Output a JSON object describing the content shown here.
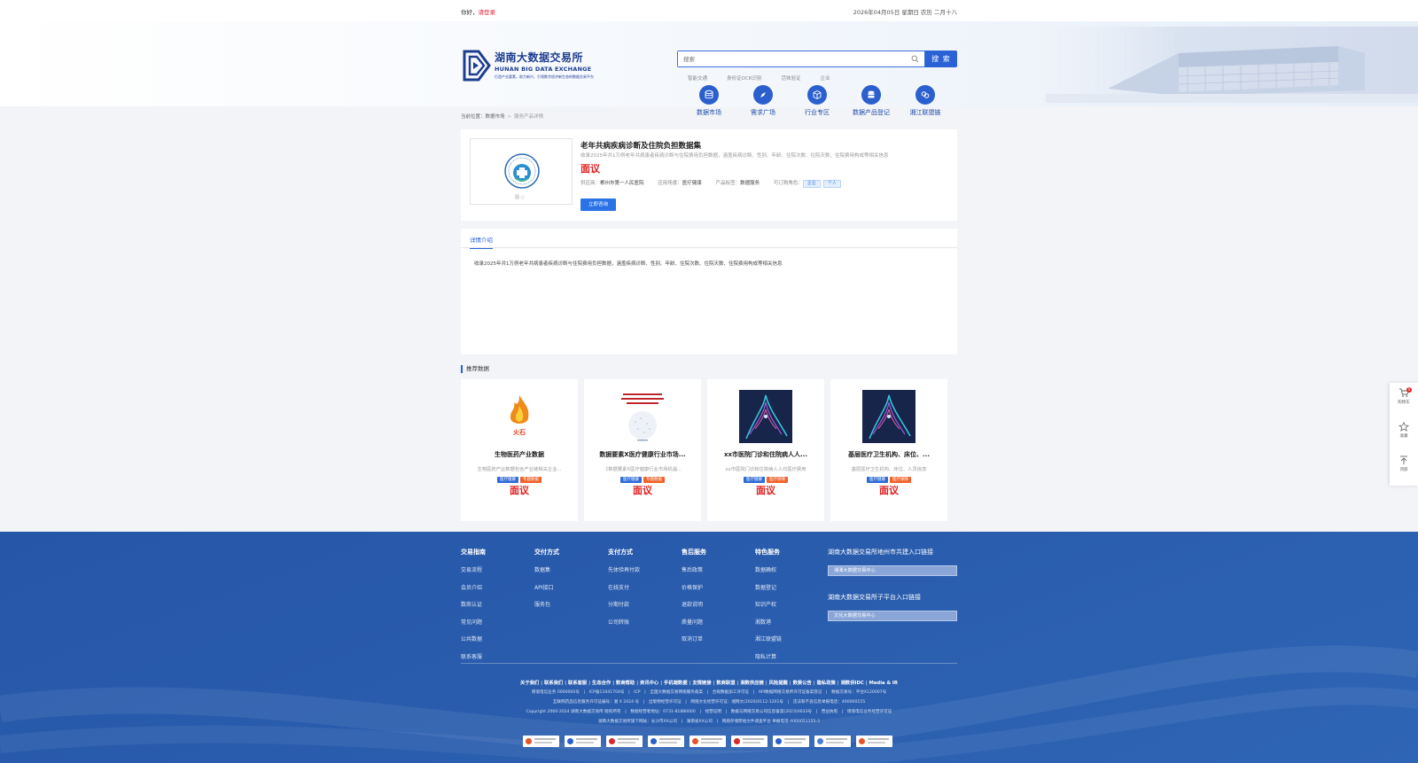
{
  "topbar": {
    "greeting": "你好，",
    "login": "请登录",
    "date": "2026年04月05日 星期日 农历 二月十八"
  },
  "logo": {
    "cn": "湖南大数据交易所",
    "en": "HUNAN BIG DATA EXCHANGE",
    "tagline": "打造产业要素，助力新兴，引领数字经济新生态的数据交易平台"
  },
  "search": {
    "placeholder": "搜索",
    "button": "搜 索",
    "hotwords": [
      "智能交通",
      "身份证OCR识别",
      "活体验证",
      "企业"
    ]
  },
  "nav": [
    {
      "label": "数据市场",
      "icon": "database-icon"
    },
    {
      "label": "需求广场",
      "icon": "compass-icon"
    },
    {
      "label": "行业专区",
      "icon": "cube-icon"
    },
    {
      "label": "数据产品登记",
      "icon": "register-icon"
    },
    {
      "label": "湘江联盟链",
      "icon": "chain-icon"
    }
  ],
  "breadcrumb": {
    "prefix": "当前位置：",
    "home": "数据市场",
    "sep": ">",
    "current": "服务产品详情"
  },
  "product": {
    "title": "老年共病疾病诊断及住院负担数据集",
    "desc": "收录2025年共1万例老年共病患者疾病诊断与住院费用负担数据，涵盖疾病诊断、性别、年龄、住院次数、住院天数、住院费用构成等相关信息",
    "price": "面议",
    "supplier_k": "供应商：",
    "supplier_v": "郴州市第一人民医院",
    "scene_k": "应用场景：",
    "scene_v": "医疗健康",
    "type_k": "产品标签：",
    "type_v": "数据服务",
    "buyer_k": "可订购角色：",
    "buyer_tags": [
      "企业",
      "个人"
    ],
    "consult": "立即咨询",
    "img_caption": "图 ○"
  },
  "detail": {
    "tab": "详情介绍",
    "text": "收录2025年共1万例老年共病患者疾病诊断与住院费用负担数据，涵盖疾病诊断、性别、年龄、住院次数、住院天数、住院费用构成等相关信息"
  },
  "recommend": {
    "title": "推荐数据",
    "items": [
      {
        "name": "生物医药产业数据",
        "desc": "生物医药产业数据包含产业链相关企业...",
        "tags": [
          "医疗健康",
          "专题数据"
        ],
        "price": "面议",
        "img": "flame-logo"
      },
      {
        "name": "数据要素X医疗健康行业市场...",
        "desc": "《数据要素X医疗健康行业市场机遇...",
        "tags": [
          "医疗健康",
          "专题数据"
        ],
        "price": "面议",
        "img": "report-cover",
        "cover_title": "数据要素×医疗健康行业市场研究报告"
      },
      {
        "name": "xx市医院门诊和住院病人人...",
        "desc": "xx市医院门诊和住院病人人均医疗费用",
        "tags": [
          "医疗健康",
          "医疗保障"
        ],
        "price": "面议",
        "img": "abstract-art"
      },
      {
        "name": "基层医疗卫生机构、床位、...",
        "desc": "基层医疗卫生机构、床位、人员信息",
        "tags": [
          "医疗健康",
          "医疗保障"
        ],
        "price": "面议",
        "img": "abstract-art"
      }
    ]
  },
  "float": {
    "cart": "购物车",
    "cart_count": "0",
    "fav": "收藏",
    "top": "顶部"
  },
  "footer": {
    "cols": [
      {
        "title": "交易指南",
        "items": [
          "交易流程",
          "会员介绍",
          "数商认证",
          "常见问题",
          "公共数据",
          "联系客服"
        ]
      },
      {
        "title": "交付方式",
        "items": [
          "数据集",
          "API接口",
          "服务包"
        ]
      },
      {
        "title": "支付方式",
        "items": [
          "先体验再付款",
          "在线支付",
          "分期付款",
          "公司转账"
        ]
      },
      {
        "title": "售后服务",
        "items": [
          "售后政策",
          "价格保护",
          "退款说明",
          "质量问题",
          "取消订单"
        ]
      },
      {
        "title": "特色服务",
        "items": [
          "数据确权",
          "数据登记",
          "知识产权",
          "湘数港",
          "湘江联盟链",
          "隐私计算"
        ]
      }
    ],
    "right_h1": "湖南大数据交易所地州市共建入口链接",
    "right_sel1": "湘潭大数据交易中心",
    "right_h2": "湖南大数据交易所子平台入口链接",
    "right_sel2": "文化大数据交易中心",
    "links": [
      "关于我们",
      "联系我们",
      "联系客服",
      "生态合作",
      "数商帮助",
      "资讯中心",
      "手机端数据",
      "友情链接",
      "数商联盟",
      "湘数供应链",
      "风险提醒",
      "数委公告",
      "隐私政策",
      "湘数供IDC",
      "Media & IR"
    ],
    "legal": [
      "增值电信业务 0000000号　|　ICP备11041704号　|　ICP　|　全国大数据交易网络服务备案　|　合规数据加工许可证　|　API数据网络交易所许可证备案登记　|　数据交易号：平台X120007号",
      "互联网药品信息服务许可证编号：湘 X 2024 号　|　出版物经营许可证　|　网络文化经营许可证：湘网文(2020)0112-1201号　|　违法和不良信息举报电话：400000155",
      "Copyright 2000-2024 湖南大数据交易所 版权所有　|　数据经营者地址：0731-81880000　|　经营证明　|　数据与网络交易公司信息备案(2023)0033号　|　营业执照　|　增值电信业务经营许可证",
      "湖南大数据交易所旗下网站：长沙市XX公司　|　湖南省XX公司　|　网络存储原始文件调查平台 举报电话 4000051155-3"
    ],
    "badges": 9
  }
}
